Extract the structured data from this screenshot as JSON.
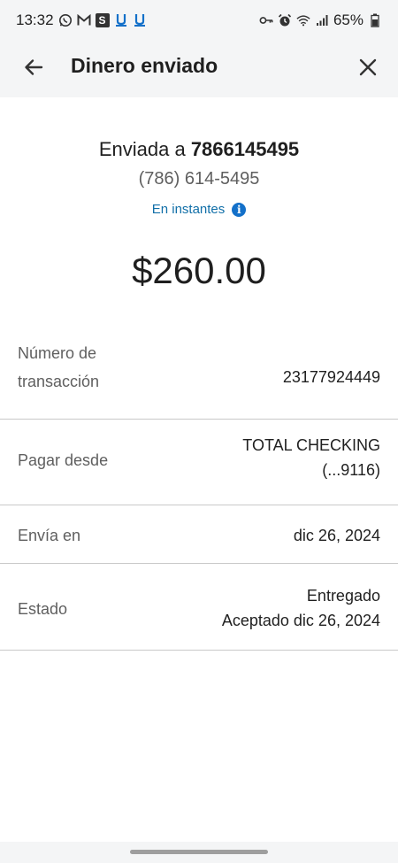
{
  "status_bar": {
    "time": "13:32",
    "left_icons": [
      "whatsapp-icon",
      "gmail-icon",
      "s-app-icon",
      "chase-icon",
      "chase-icon"
    ],
    "s_app_letter": "S",
    "right_icons": [
      "key-icon",
      "alarm-icon",
      "wifi-icon",
      "signal-icon"
    ],
    "battery": "65%"
  },
  "app_bar": {
    "title": "Dinero enviado",
    "back_icon": "arrow-left-icon",
    "close_icon": "close-icon"
  },
  "summary": {
    "sent_prefix": "Enviada a",
    "recipient": "7866145495",
    "phone_formatted": "(786) 614-5495",
    "speed": "En instantes",
    "info_icon": "info-icon",
    "info_icon_glyph": "i",
    "amount": "$260.00"
  },
  "details": [
    {
      "label_line1": "Número de",
      "label_line2": "transacción",
      "value_line1": "23177924449",
      "value_line2": ""
    },
    {
      "label_line1": "Pagar desde",
      "label_line2": "",
      "value_line1": "TOTAL CHECKING",
      "value_line2": "(...9116)"
    },
    {
      "label_line1": "Envía en",
      "label_line2": "",
      "value_line1": "dic 26, 2024",
      "value_line2": ""
    },
    {
      "label_line1": "Estado",
      "label_line2": "",
      "value_line1": "Entregado",
      "value_line2": "Aceptado dic 26, 2024"
    }
  ],
  "colors": {
    "accent_link": "#116fa8",
    "info_icon_bg": "#1370c9",
    "chrome_bg": "#f4f5f6",
    "divider": "#c9c9c9"
  }
}
